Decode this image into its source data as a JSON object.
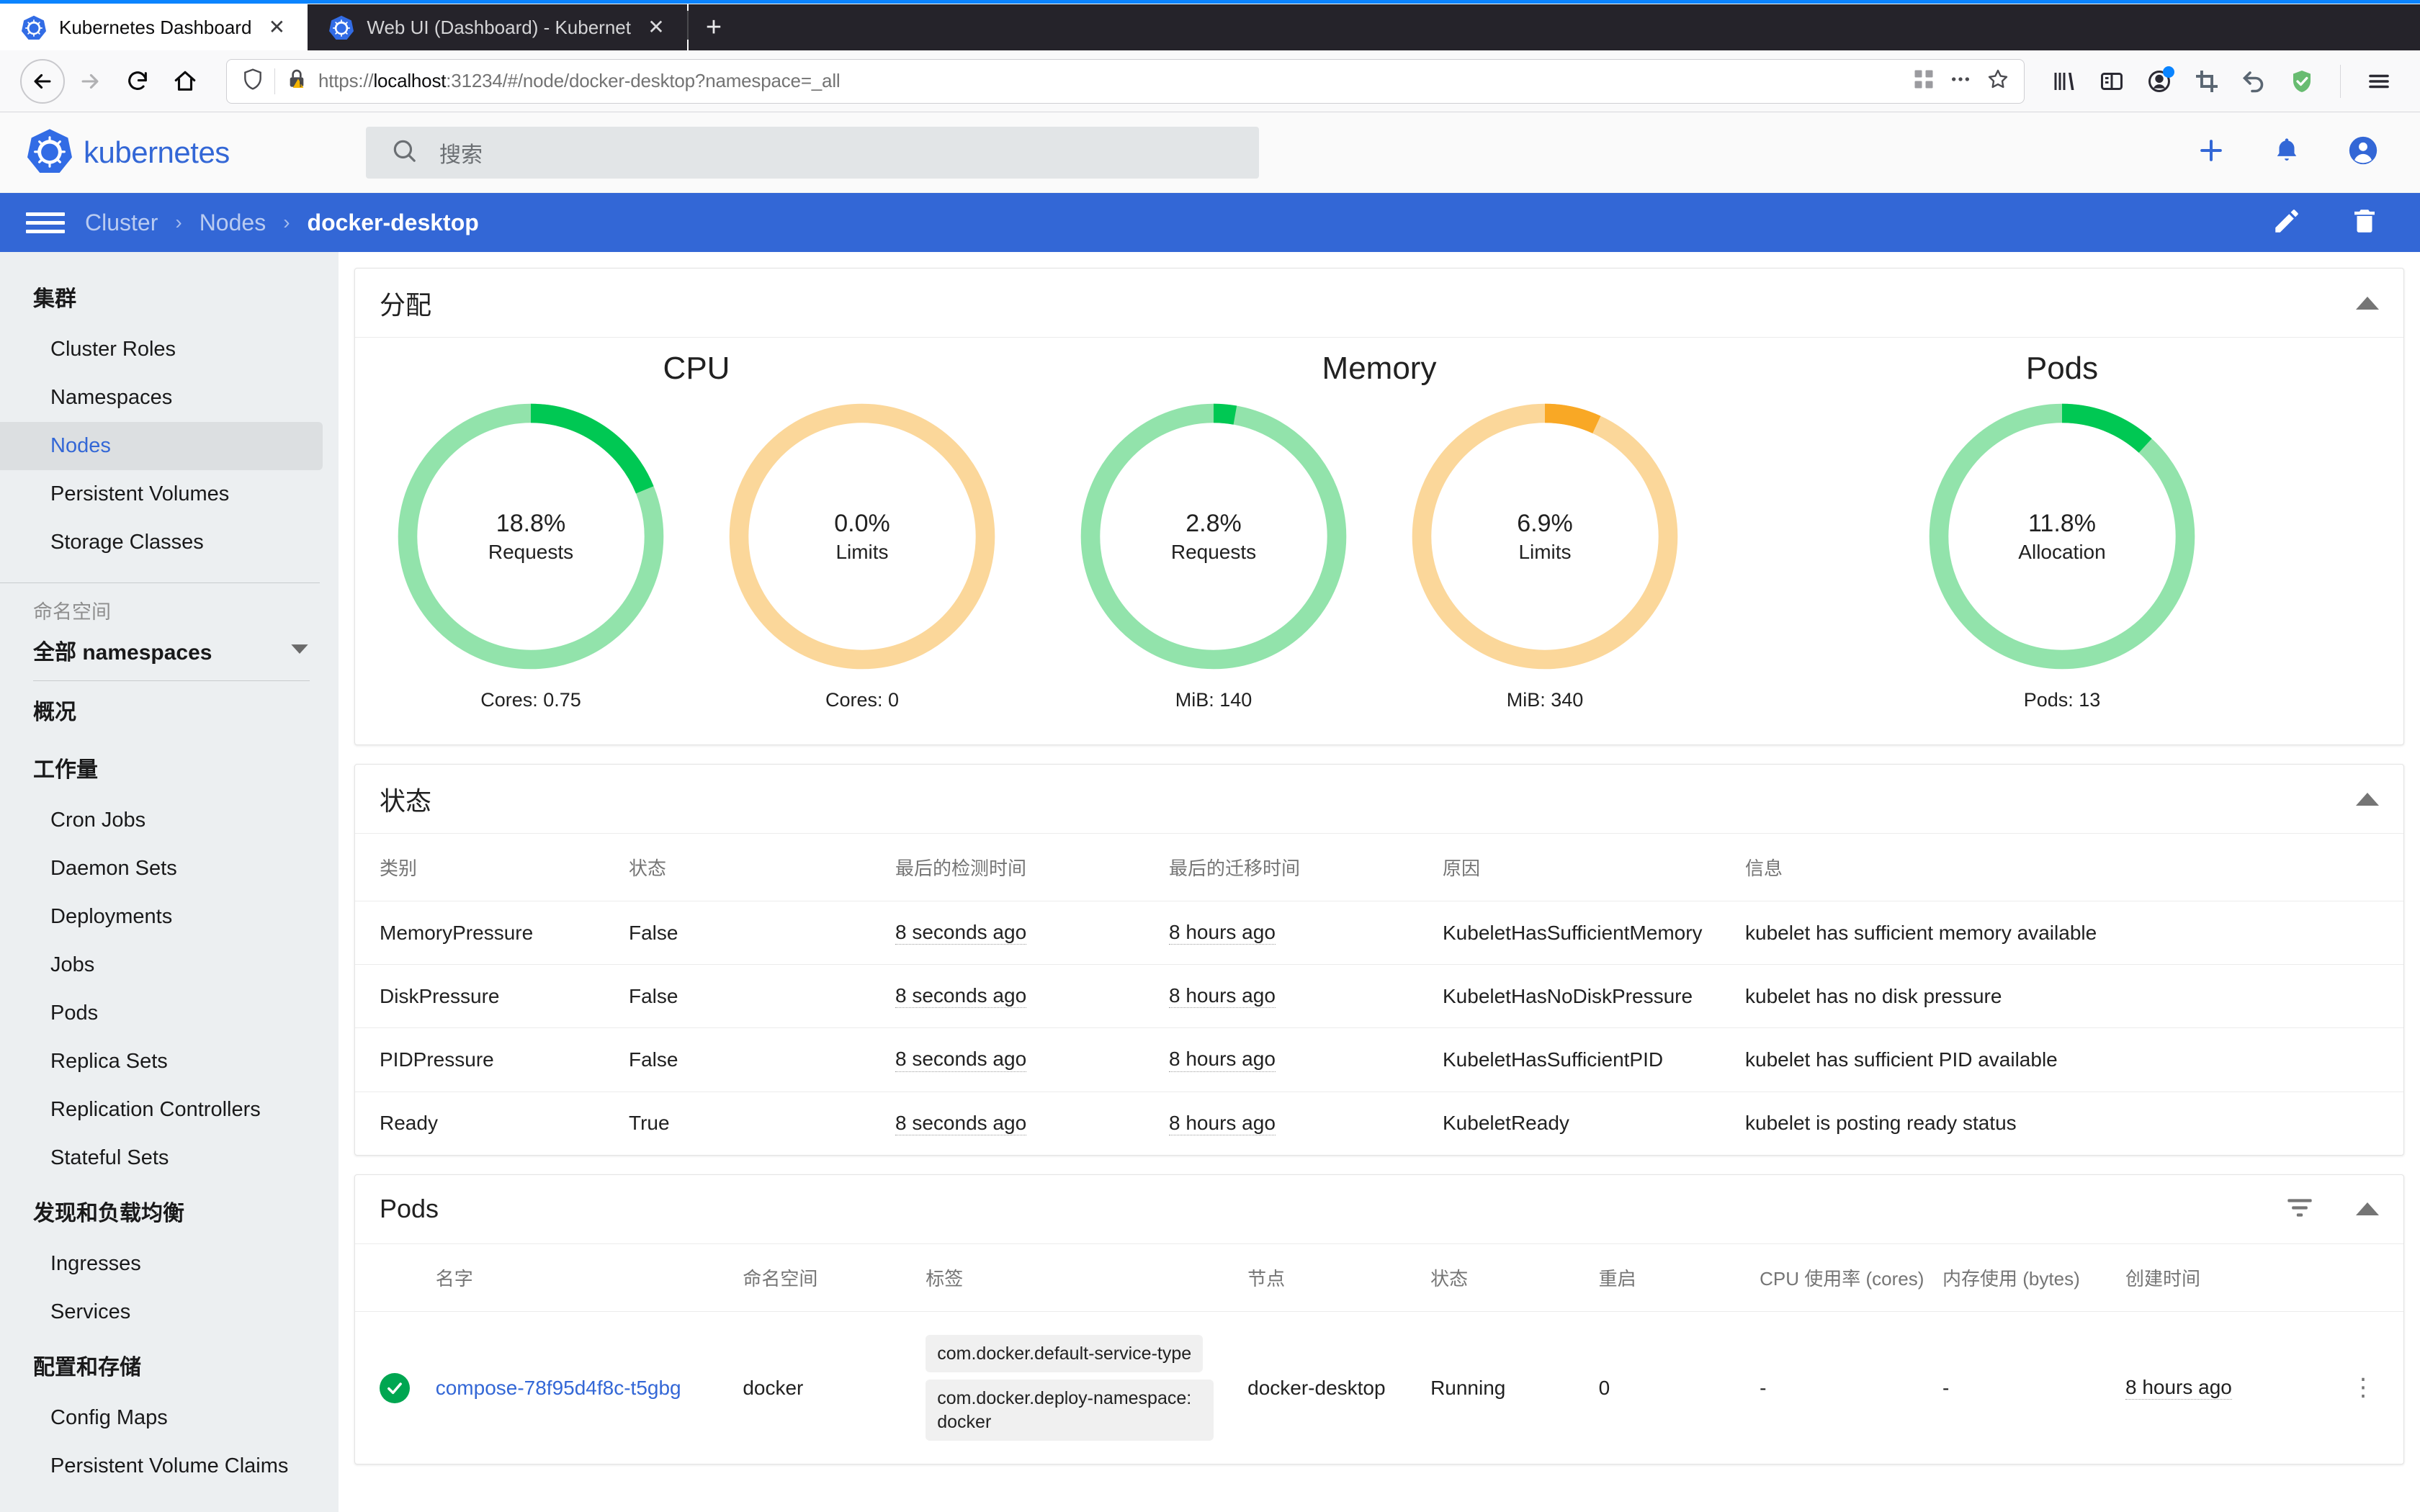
{
  "browser": {
    "tabs": [
      {
        "title": "Kubernetes Dashboard",
        "favicon": "kubernetes-icon",
        "close": "✕",
        "active": true
      },
      {
        "title": "Web UI (Dashboard) - Kubernet",
        "favicon": "kubernetes-icon",
        "close": "✕",
        "active": false
      }
    ],
    "new_tab_label": "+",
    "nav": {
      "back": "back-icon",
      "forward": "forward-icon",
      "reload": "reload-icon",
      "home": "home-icon"
    },
    "url": {
      "scheme": "https://",
      "host": "localhost",
      "rest": ":31234/#/node/docker-desktop?namespace=_all",
      "full": "https://localhost:31234/#/node/docker-desktop?namespace=_all",
      "shield_icon": "shield-icon",
      "lock_icon": "lock-warning-icon"
    },
    "urlbar_right": [
      "qr-code-icon",
      "ellipsis-icon",
      "star-icon"
    ],
    "toolbar_right": [
      "library-icon",
      "sidebar-icon",
      "account-icon",
      "screenshot-crop-icon",
      "undo-icon",
      "adguard-shield-icon",
      "app-menu-icon"
    ]
  },
  "header": {
    "brand": "kubernetes",
    "logo_icon": "kubernetes-logo-icon",
    "search_icon": "search-icon",
    "search_placeholder": "搜索",
    "actions": [
      "plus-icon",
      "bell-icon",
      "account-circle-icon"
    ]
  },
  "breadcrumb": {
    "menu_icon": "hamburger-menu-icon",
    "items": [
      "Cluster",
      "Nodes",
      "docker-desktop"
    ],
    "separator": "›",
    "actions": [
      "edit-pencil-icon",
      "delete-trash-icon"
    ]
  },
  "sidebar": {
    "sections": [
      {
        "title": "集群",
        "items": [
          {
            "label": "Cluster Roles",
            "active": false
          },
          {
            "label": "Namespaces",
            "active": false
          },
          {
            "label": "Nodes",
            "active": true
          },
          {
            "label": "Persistent Volumes",
            "active": false
          },
          {
            "label": "Storage Classes",
            "active": false
          }
        ]
      }
    ],
    "namespace": {
      "label": "命名空间",
      "selected": "全部 namespaces",
      "caret_icon": "chevron-down-icon"
    },
    "overview_title": "概况",
    "workloads": {
      "title": "工作量",
      "items": [
        {
          "label": "Cron Jobs"
        },
        {
          "label": "Daemon Sets"
        },
        {
          "label": "Deployments"
        },
        {
          "label": "Jobs"
        },
        {
          "label": "Pods"
        },
        {
          "label": "Replica Sets"
        },
        {
          "label": "Replication Controllers"
        },
        {
          "label": "Stateful Sets"
        }
      ]
    },
    "discovery": {
      "title": "发现和负载均衡",
      "items": [
        {
          "label": "Ingresses"
        },
        {
          "label": "Services"
        }
      ]
    },
    "config": {
      "title": "配置和存储",
      "items": [
        {
          "label": "Config Maps"
        },
        {
          "label": "Persistent Volume Claims"
        }
      ]
    }
  },
  "allocation": {
    "title": "分配",
    "collapse_icon": "collapse-caret-icon",
    "colors": {
      "green_fill": "#00c853",
      "green_track": "#92e3ab",
      "orange_fill": "#f9a825",
      "orange_track": "#fbd79a"
    },
    "groups": [
      {
        "name": "CPU",
        "donuts": [
          {
            "percent_label": "18.8%",
            "percent_value": 18.8,
            "kind": "Requests",
            "footer": "Cores: 0.75",
            "color": "green"
          },
          {
            "percent_label": "0.0%",
            "percent_value": 0.0,
            "kind": "Limits",
            "footer": "Cores: 0",
            "color": "orange"
          }
        ]
      },
      {
        "name": "Memory",
        "donuts": [
          {
            "percent_label": "2.8%",
            "percent_value": 2.8,
            "kind": "Requests",
            "footer": "MiB: 140",
            "color": "green"
          },
          {
            "percent_label": "6.9%",
            "percent_value": 6.9,
            "kind": "Limits",
            "footer": "MiB: 340",
            "color": "orange"
          }
        ]
      },
      {
        "name": "Pods",
        "donuts": [
          {
            "percent_label": "11.8%",
            "percent_value": 11.8,
            "kind": "Allocation",
            "footer": "Pods: 13",
            "color": "green"
          }
        ]
      }
    ]
  },
  "chart_data": {
    "type": "pie",
    "title": "分配 (Allocation)",
    "series": [
      {
        "name": "CPU Requests",
        "value": 18.8,
        "unit": "%",
        "total_label": "Cores: 0.75",
        "color": "#00c853"
      },
      {
        "name": "CPU Limits",
        "value": 0.0,
        "unit": "%",
        "total_label": "Cores: 0",
        "color": "#f9a825"
      },
      {
        "name": "Memory Requests",
        "value": 2.8,
        "unit": "%",
        "total_label": "MiB: 140",
        "color": "#00c853"
      },
      {
        "name": "Memory Limits",
        "value": 6.9,
        "unit": "%",
        "total_label": "MiB: 340",
        "color": "#f9a825"
      },
      {
        "name": "Pods Allocation",
        "value": 11.8,
        "unit": "%",
        "total_label": "Pods: 13",
        "color": "#00c853"
      }
    ],
    "ylim": [
      0,
      100
    ],
    "legend": "none",
    "grid": false
  },
  "conditions": {
    "title": "状态",
    "collapse_icon": "collapse-caret-icon",
    "columns": [
      "类别",
      "状态",
      "最后的检测时间",
      "最后的迁移时间",
      "原因",
      "信息"
    ],
    "rows": [
      {
        "type": "MemoryPressure",
        "status": "False",
        "last_heartbeat": "8 seconds ago",
        "last_transition": "8 hours ago",
        "reason": "KubeletHasSufficientMemory",
        "message": "kubelet has sufficient memory available"
      },
      {
        "type": "DiskPressure",
        "status": "False",
        "last_heartbeat": "8 seconds ago",
        "last_transition": "8 hours ago",
        "reason": "KubeletHasNoDiskPressure",
        "message": "kubelet has no disk pressure"
      },
      {
        "type": "PIDPressure",
        "status": "False",
        "last_heartbeat": "8 seconds ago",
        "last_transition": "8 hours ago",
        "reason": "KubeletHasSufficientPID",
        "message": "kubelet has sufficient PID available"
      },
      {
        "type": "Ready",
        "status": "True",
        "last_heartbeat": "8 seconds ago",
        "last_transition": "8 hours ago",
        "reason": "KubeletReady",
        "message": "kubelet is posting ready status"
      }
    ]
  },
  "pods": {
    "title": "Pods",
    "filter_icon": "filter-icon",
    "collapse_icon": "collapse-caret-icon",
    "columns": [
      "名字",
      "命名空间",
      "标签",
      "节点",
      "状态",
      "重启",
      "CPU 使用率 (cores)",
      "内存使用 (bytes)",
      "创建时间"
    ],
    "rows": [
      {
        "status_icon": "check-circle-icon",
        "name": "compose-78f95d4f8c-t5gbg",
        "namespace": "docker",
        "labels": [
          "com.docker.default-service-type",
          "com.docker.deploy-namespace: docker"
        ],
        "node": "docker-desktop",
        "status": "Running",
        "restarts": "0",
        "cpu": "-",
        "memory": "-",
        "created": "8 hours ago",
        "menu_icon": "kebab-menu-icon"
      }
    ]
  }
}
